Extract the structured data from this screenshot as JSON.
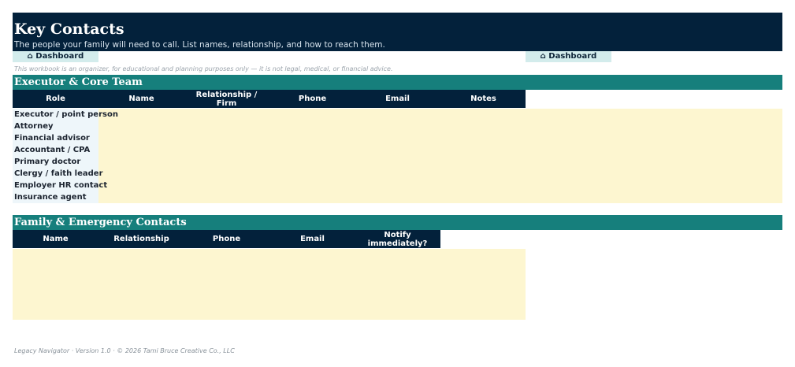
{
  "header": {
    "title": "Key Contacts",
    "subtitle": "The people your family will need to call. List names, relationship, and how to reach them."
  },
  "nav": {
    "dashboard_left": "⌂ Dashboard",
    "dashboard_right": "⌂ Dashboard"
  },
  "disclaimer": "This workbook is an organizer, for educational and planning purposes only — it is not legal, medical, or financial advice.",
  "core_team": {
    "title": "Executor & Core Team",
    "columns": [
      "Role",
      "Name",
      "Relationship /\nFirm",
      "Phone",
      "Email",
      "Notes"
    ],
    "roles": [
      "Executor / point person",
      "Attorney",
      "Financial advisor",
      "Accountant / CPA",
      "Primary doctor",
      "Clergy / faith leader",
      "Employer HR contact",
      "Insurance agent"
    ]
  },
  "family": {
    "title": "Family & Emergency Contacts",
    "columns": [
      "Name",
      "Relationship",
      "Phone",
      "Email",
      "Notify\nimmediately?"
    ]
  },
  "footer": "Legacy Navigator · Version 1.0 · © 2026 Tami Bruce Creative Co., LLC",
  "colors": {
    "navy": "#03213b",
    "teal": "#167f7c",
    "input_fill": "#fdf6d0",
    "nav_button": "#d3ecec"
  }
}
